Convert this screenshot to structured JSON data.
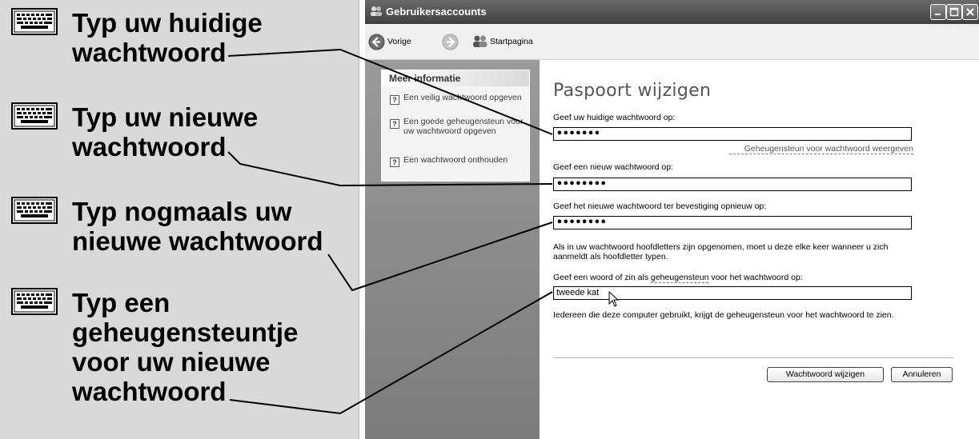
{
  "instructions": [
    {
      "icon": "keyboard-icon",
      "lines": [
        "Typ uw huidige",
        "wachtwoord"
      ]
    },
    {
      "icon": "keyboard-icon",
      "lines": [
        "Typ uw nieuwe",
        "wachtwoord"
      ]
    },
    {
      "icon": "keyboard-icon",
      "lines": [
        "Typ nogmaals uw",
        "nieuwe wachtwoord"
      ]
    },
    {
      "icon": "keyboard-icon",
      "lines": [
        "Typ een",
        "geheugensteuntje",
        "voor uw nieuwe",
        "wachtwoord"
      ]
    }
  ],
  "window": {
    "title": "Gebruikersaccounts",
    "title_icon": "user-accounts-icon"
  },
  "toolbar": {
    "back_label": "Vorige",
    "home_label": "Startpagina"
  },
  "taskpane": {
    "header": "Meer informatie",
    "items": [
      {
        "icon": "help-icon",
        "label": "Een veilig wachtwoord opgeven"
      },
      {
        "icon": "help-icon",
        "label": "Een goede geheugensteun voor uw wachtwoord opgeven"
      },
      {
        "icon": "help-icon",
        "label": "Een wachtwoord onthouden"
      }
    ]
  },
  "main": {
    "title": "Paspoort wijzigen",
    "current_pw_label": "Geef uw huidige wachtwoord op:",
    "current_pw_value": "•••••••",
    "show_hint_link": "Geheugensteun voor wachtwoord weergeven",
    "new_pw_label": "Geef een nieuw wachtwoord op:",
    "new_pw_value": "••••••••",
    "confirm_pw_label": "Geef het nieuwe wachtwoord ter bevestiging opnieuw op:",
    "confirm_pw_value": "••••••••",
    "case_note": "Als in uw wachtwoord hoofdletters zijn opgenomen, moet u deze elke keer wanneer u zich aanmeldt als hoofdletter typen.",
    "hint_label_pre": "Geef een woord of zin als ",
    "hint_label_link": "geheugensteun",
    "hint_label_post": " voor het wachtwoord op:",
    "hint_value": "tweede kat",
    "hint_note": "Iedereen die deze computer gebruikt, krijgt de geheugensteun voor het wachtwoord te zien.",
    "change_button": "Wachtwoord wijzigen",
    "cancel_button": "Annuleren"
  },
  "colors": {
    "left_panel_bg": "#d9d9d9",
    "titlebar": "#4f4f4f",
    "taskpane": "#8c8c8c"
  }
}
